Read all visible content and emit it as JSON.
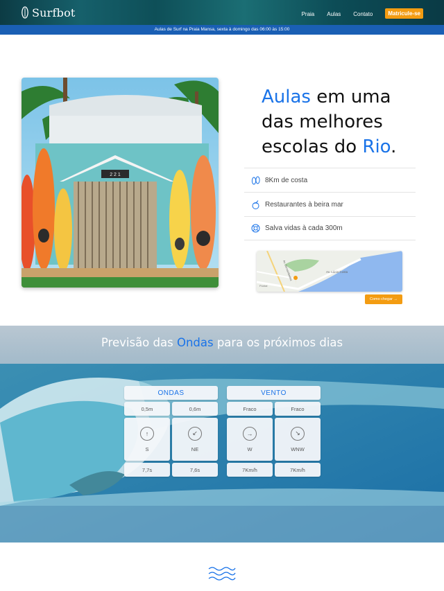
{
  "header": {
    "logo_text": "Surfbot",
    "logo_icon": "surfboard-icon",
    "nav": [
      "Praia",
      "Aulas",
      "Contato"
    ],
    "cta": "Matricule-se",
    "cta_color": "#f39c12"
  },
  "announcement": "Aulas de Surf na Praia Mansa, sexta à domingo das 06:00 às 15:00",
  "hero": {
    "title_accent_1": "Aulas",
    "title_part_1": " em uma das melhores escolas do ",
    "title_accent_2": "Rio",
    "title_end": ".",
    "accent_color": "#1a73e8",
    "photo_sign": "2 2 1",
    "features": [
      {
        "icon": "flip-flops-icon",
        "text": "8Km de costa"
      },
      {
        "icon": "coconut-drink-icon",
        "text": "Restaurantes à beira mar"
      },
      {
        "icon": "lifebuoy-icon",
        "text": "Salva vidas à cada 300m"
      }
    ],
    "map_labels": [
      "Av. Lúcio Costa",
      "Av. Sernambetiba",
      "Pontal"
    ],
    "map_button": "Como chegar →"
  },
  "forecast": {
    "title_part_1": "Previsão das ",
    "title_accent": "Ondas",
    "title_part_2": " para os próximos dias",
    "ondas": {
      "title": "ONDAS",
      "heights": [
        "0,5m",
        "0,6m"
      ],
      "directions": [
        {
          "arrow": "↑",
          "label": "S"
        },
        {
          "arrow": "↙",
          "label": "NE"
        }
      ],
      "periods": [
        "7,7s",
        "7,6s"
      ]
    },
    "vento": {
      "title": "VENTO",
      "strengths": [
        "Fraco",
        "Fraco"
      ],
      "directions": [
        {
          "arrow": "→",
          "label": "W"
        },
        {
          "arrow": "↘",
          "label": "WNW"
        }
      ],
      "speeds": [
        "7Km/h",
        "7Km/h"
      ]
    }
  },
  "footer_icon": "waves-icon"
}
